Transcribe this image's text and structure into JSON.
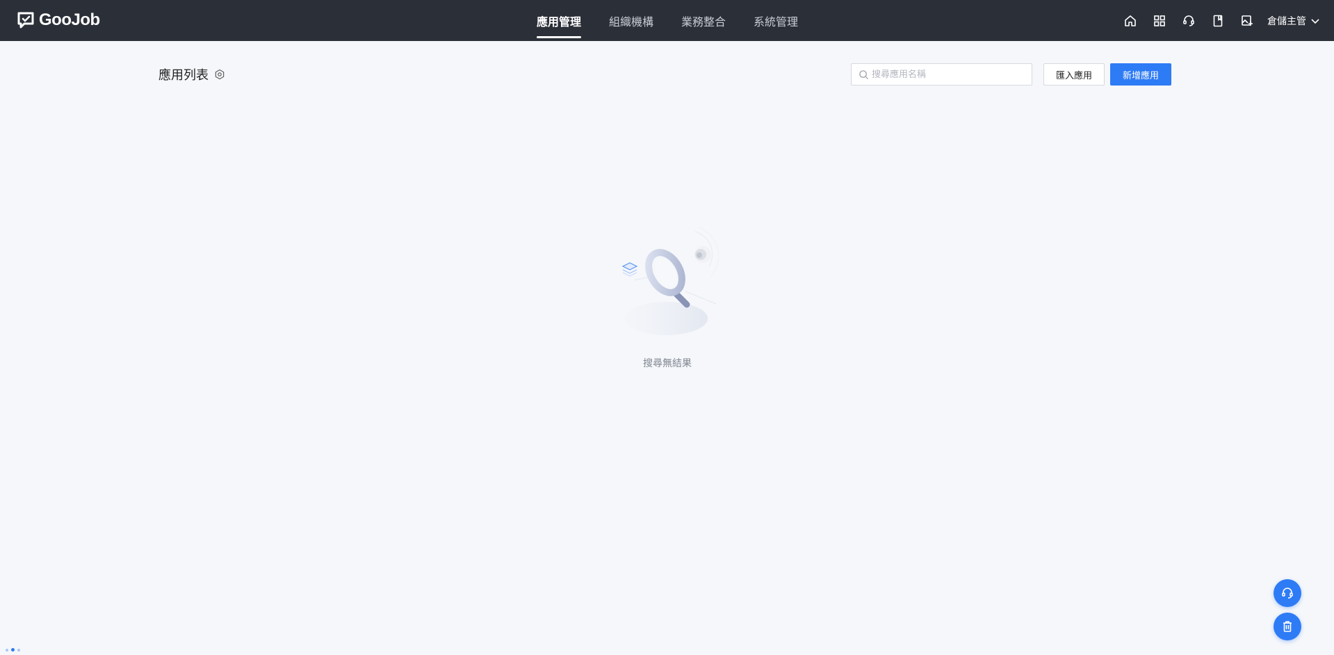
{
  "app": {
    "brand": "GooJob"
  },
  "nav": {
    "items": [
      {
        "label": "應用管理",
        "active": true
      },
      {
        "label": "組織機構",
        "active": false
      },
      {
        "label": "業務整合",
        "active": false
      },
      {
        "label": "系統管理",
        "active": false
      }
    ]
  },
  "header_icons": [
    "home-icon",
    "apps-grid-icon",
    "support-headset-icon",
    "book-icon",
    "image-add-icon"
  ],
  "user": {
    "name": "倉儲主管"
  },
  "page": {
    "title": "應用列表",
    "search_placeholder": "搜尋應用名稱",
    "import_label": "匯入應用",
    "new_label": "新增應用"
  },
  "empty_state": {
    "text": "搜尋無結果"
  },
  "colors": {
    "topbar": "#2b2f38",
    "primary": "#2e7bf6",
    "background": "#f5f7fa"
  }
}
